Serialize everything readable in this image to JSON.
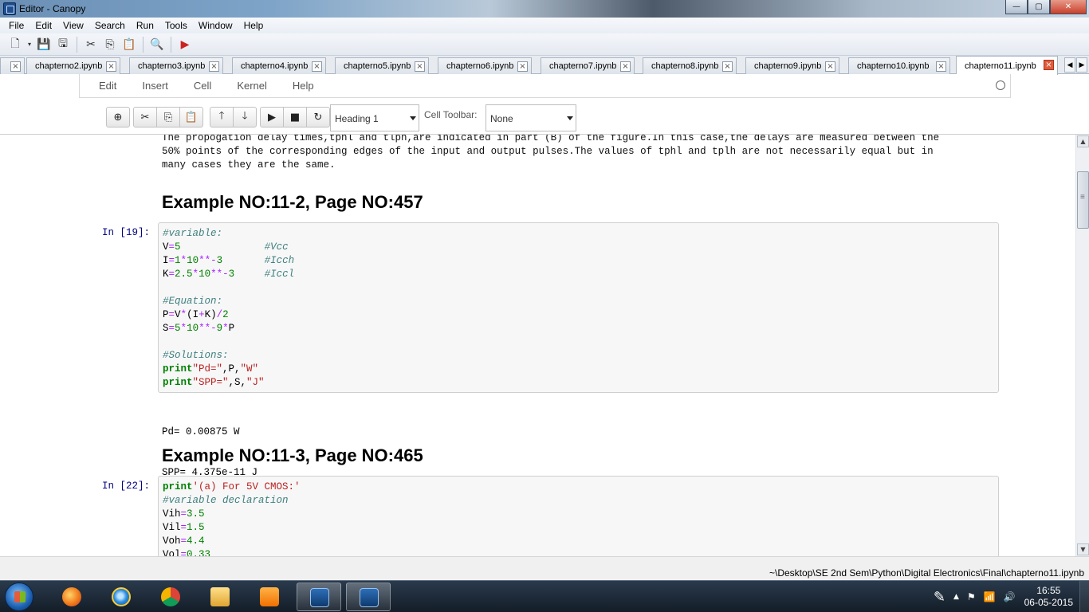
{
  "window": {
    "title": "Editor - Canopy",
    "minimize": "—",
    "maximize": "▢",
    "close": "✕"
  },
  "menu": [
    "File",
    "Edit",
    "View",
    "Search",
    "Run",
    "Tools",
    "Window",
    "Help"
  ],
  "tabs": [
    "chapterno2.ipynb",
    "chapterno3.ipynb",
    "chapterno4.ipynb",
    "chapterno5.ipynb",
    "chapterno6.ipynb",
    "chapterno7.ipynb",
    "chapterno8.ipynb",
    "chapterno9.ipynb",
    "chapterno10.ipynb",
    "chapterno11.ipynb"
  ],
  "active_tab": "chapterno11.ipynb",
  "nb_menu": [
    "Edit",
    "Insert",
    "Cell",
    "Kernel",
    "Help"
  ],
  "nb_toolbar": {
    "cell_type": "Heading 1",
    "cell_toolbar_label": "Cell Toolbar:",
    "cell_toolbar_value": "None"
  },
  "notebook": {
    "intro_lines": [
      "The propogation delay times,tphl and tlph,are indicated in part (B) of the figure.In this case,the delays are measured between the",
      "50% points of the corresponding edges of the input and output pulses.The values of tphl and tplh are not necessarily equal but in",
      "many cases they are the same."
    ],
    "heading1": "Example NO:11-2, Page NO:457",
    "cell1": {
      "prompt": "In [19]:",
      "lines": [
        "#variable:",
        "V=5              #Vcc",
        "I=1*10**-3       #Icch",
        "K=2.5*10**-3     #Iccl",
        "",
        "#Equation:",
        "P=V*(I+K)/2",
        "S=5*10**-9*P",
        "",
        "#Solutions:",
        "print\"Pd=\",P,\"W\"",
        "print\"SPP=\",S,\"J\""
      ],
      "output": [
        "Pd= 0.00875 W",
        "SPP= 4.375e-11 J"
      ]
    },
    "heading2": "Example NO:11-3, Page NO:465",
    "cell2": {
      "prompt": "In [22]:",
      "lines": [
        "print'(a) For 5V CMOS:'",
        "#variable declaration",
        "Vih=3.5",
        "Vil=1.5",
        "Voh=4.4",
        "Vol=0.33"
      ]
    }
  },
  "status_path": "~\\Desktop\\SE 2nd Sem\\Python\\Digital Electronics\\Final\\chapterno11.ipynb",
  "clock": {
    "time": "16:55",
    "date": "06-05-2015"
  }
}
